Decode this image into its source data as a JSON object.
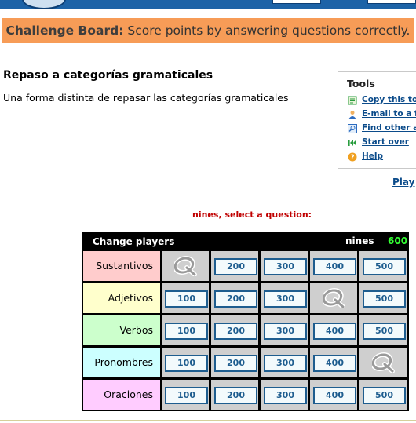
{
  "banner": {
    "bold": "Challenge Board:",
    "text": " Score points by answering questions correctly."
  },
  "page": {
    "title": "Repaso a categorías gramaticales",
    "subtitle": "Una forma distinta de repasar las categorías gramaticales"
  },
  "tools": {
    "heading": "Tools",
    "items": [
      {
        "label": "Copy this to",
        "icon": "copy-icon",
        "color": "#2a9d3f"
      },
      {
        "label": "E-mail to a f",
        "icon": "email-person-icon",
        "color": "#2d6cc0"
      },
      {
        "label": "Find other a",
        "icon": "find-icon",
        "color": "#2d6cc0"
      },
      {
        "label": "Start over",
        "icon": "rewind-icon",
        "color": "#2a9d3f"
      },
      {
        "label": "Help",
        "icon": "help-icon",
        "color": "#f0a020"
      }
    ]
  },
  "play_link": "Play",
  "prompt": "nines, select a question:",
  "board": {
    "change_players": "Change players",
    "player_name": "nines",
    "player_score": "600",
    "categories": [
      {
        "name": "Sustantivos",
        "color": "#ffcccc",
        "cells": [
          "",
          "200",
          "300",
          "400",
          "500"
        ]
      },
      {
        "name": "Adjetivos",
        "color": "#ffffcc",
        "cells": [
          "100",
          "200",
          "300",
          "",
          "500"
        ]
      },
      {
        "name": "Verbos",
        "color": "#ccffcc",
        "cells": [
          "100",
          "200",
          "300",
          "400",
          "500"
        ]
      },
      {
        "name": "Pronombres",
        "color": "#ccffff",
        "cells": [
          "100",
          "200",
          "300",
          "400",
          ""
        ]
      },
      {
        "name": "Oraciones",
        "color": "#ffccff",
        "cells": [
          "100",
          "200",
          "300",
          "400",
          "500"
        ]
      }
    ]
  }
}
